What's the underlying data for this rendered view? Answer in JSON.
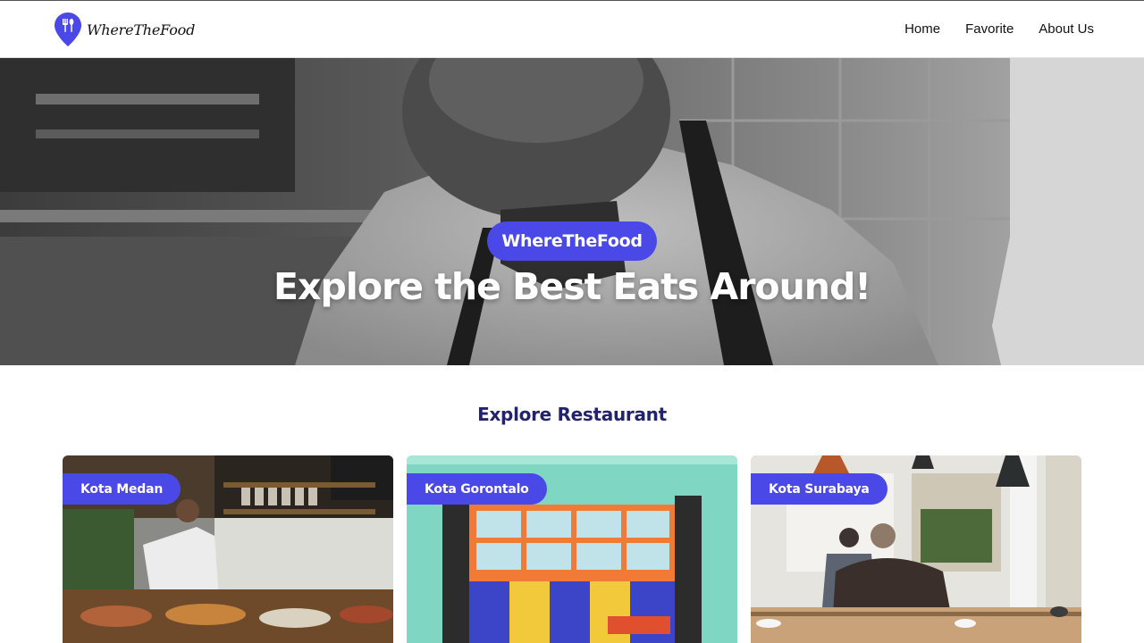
{
  "brand": {
    "name": "WhereTheFood",
    "color": "#4a48e6"
  },
  "nav": {
    "items": [
      "Home",
      "Favorite",
      "About Us"
    ]
  },
  "hero": {
    "badge": "WhereTheFood",
    "title": "Explore the Best Eats Around!"
  },
  "section": {
    "title": "Explore Restaurant"
  },
  "cards": [
    {
      "city": "Kota Medan"
    },
    {
      "city": "Kota Gorontalo"
    },
    {
      "city": "Kota Surabaya"
    }
  ]
}
